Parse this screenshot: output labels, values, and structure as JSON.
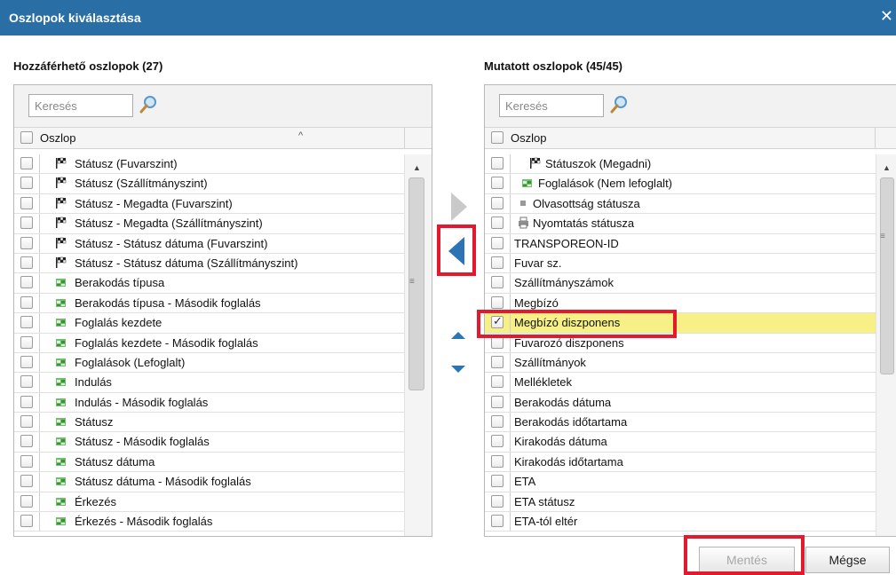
{
  "dialog": {
    "title": "Oszlopok kiválasztása",
    "close_glyph": "✕"
  },
  "left": {
    "title": "Hozzáférhető oszlopok (27)",
    "search_placeholder": "Keresés",
    "header_label": "Oszlop",
    "sort_glyph": "^",
    "rows": [
      {
        "icon": "flag-icon",
        "label": "Státusz (Fuvarszint)",
        "checked": false
      },
      {
        "icon": "flag-icon",
        "label": "Státusz (Szállítmányszint)",
        "checked": false
      },
      {
        "icon": "flag-icon",
        "label": "Státusz - Megadta (Fuvarszint)",
        "checked": false
      },
      {
        "icon": "flag-icon",
        "label": "Státusz - Megadta (Szállítmányszint)",
        "checked": false
      },
      {
        "icon": "flag-icon",
        "label": "Státusz - Státusz dátuma (Fuvarszint)",
        "checked": false
      },
      {
        "icon": "flag-icon",
        "label": "Státusz - Státusz dátuma (Szállítmányszint)",
        "checked": false
      },
      {
        "icon": "booking-icon",
        "label": "Berakodás típusa",
        "checked": false
      },
      {
        "icon": "booking-icon",
        "label": "Berakodás típusa - Második foglalás",
        "checked": false
      },
      {
        "icon": "booking-icon",
        "label": "Foglalás kezdete",
        "checked": false
      },
      {
        "icon": "booking-icon",
        "label": "Foglalás kezdete - Második foglalás",
        "checked": false
      },
      {
        "icon": "booking-icon",
        "label": "Foglalások (Lefoglalt)",
        "checked": false
      },
      {
        "icon": "booking-icon",
        "label": "Indulás",
        "checked": false
      },
      {
        "icon": "booking-icon",
        "label": "Indulás - Második foglalás",
        "checked": false
      },
      {
        "icon": "booking-icon",
        "label": "Státusz",
        "checked": false
      },
      {
        "icon": "booking-icon",
        "label": "Státusz - Második foglalás",
        "checked": false
      },
      {
        "icon": "booking-icon",
        "label": "Státusz dátuma",
        "checked": false
      },
      {
        "icon": "booking-icon",
        "label": "Státusz dátuma - Második foglalás",
        "checked": false
      },
      {
        "icon": "booking-icon",
        "label": "Érkezés",
        "checked": false
      },
      {
        "icon": "booking-icon",
        "label": "Érkezés - Második foglalás",
        "checked": false
      }
    ]
  },
  "right": {
    "title": "Mutatott oszlopok (45/45)",
    "search_placeholder": "Keresés",
    "header_label": "Oszlop",
    "rows": [
      {
        "icon": "flag-icon",
        "label": "Státuszok (Megadni)",
        "checked": false
      },
      {
        "icon": "booking-icon",
        "label": "Foglalások (Nem lefoglalt)",
        "checked": false
      },
      {
        "icon": "read-status-icon",
        "label": "Olvasottság státusza",
        "checked": false
      },
      {
        "icon": "printer-icon",
        "label": "Nyomtatás státusza",
        "checked": false
      },
      {
        "icon": "",
        "label": "TRANSPOREON-ID",
        "checked": false
      },
      {
        "icon": "",
        "label": "Fuvar sz.",
        "checked": false
      },
      {
        "icon": "",
        "label": "Szállítmányszámok",
        "checked": false
      },
      {
        "icon": "",
        "label": "Megbízó",
        "checked": false
      },
      {
        "icon": "",
        "label": "Megbízó diszponens",
        "checked": true
      },
      {
        "icon": "",
        "label": "Fuvarozó diszponens",
        "checked": false
      },
      {
        "icon": "",
        "label": "Szállítmányok",
        "checked": false
      },
      {
        "icon": "",
        "label": "Mellékletek",
        "checked": false
      },
      {
        "icon": "",
        "label": "Berakodás dátuma",
        "checked": false
      },
      {
        "icon": "",
        "label": "Berakodás időtartama",
        "checked": false
      },
      {
        "icon": "",
        "label": "Kirakodás dátuma",
        "checked": false
      },
      {
        "icon": "",
        "label": "Kirakodás időtartama",
        "checked": false
      },
      {
        "icon": "",
        "label": "ETA",
        "checked": false
      },
      {
        "icon": "",
        "label": "ETA státusz",
        "checked": false
      },
      {
        "icon": "",
        "label": "ETA-tól eltér",
        "checked": false
      }
    ]
  },
  "buttons": {
    "save": "Mentés",
    "cancel": "Mégse"
  },
  "colors": {
    "titlebar": "#2a6ea6",
    "highlight": "#f6f087",
    "annotation": "#e3192f",
    "accent": "#2c74b6"
  }
}
